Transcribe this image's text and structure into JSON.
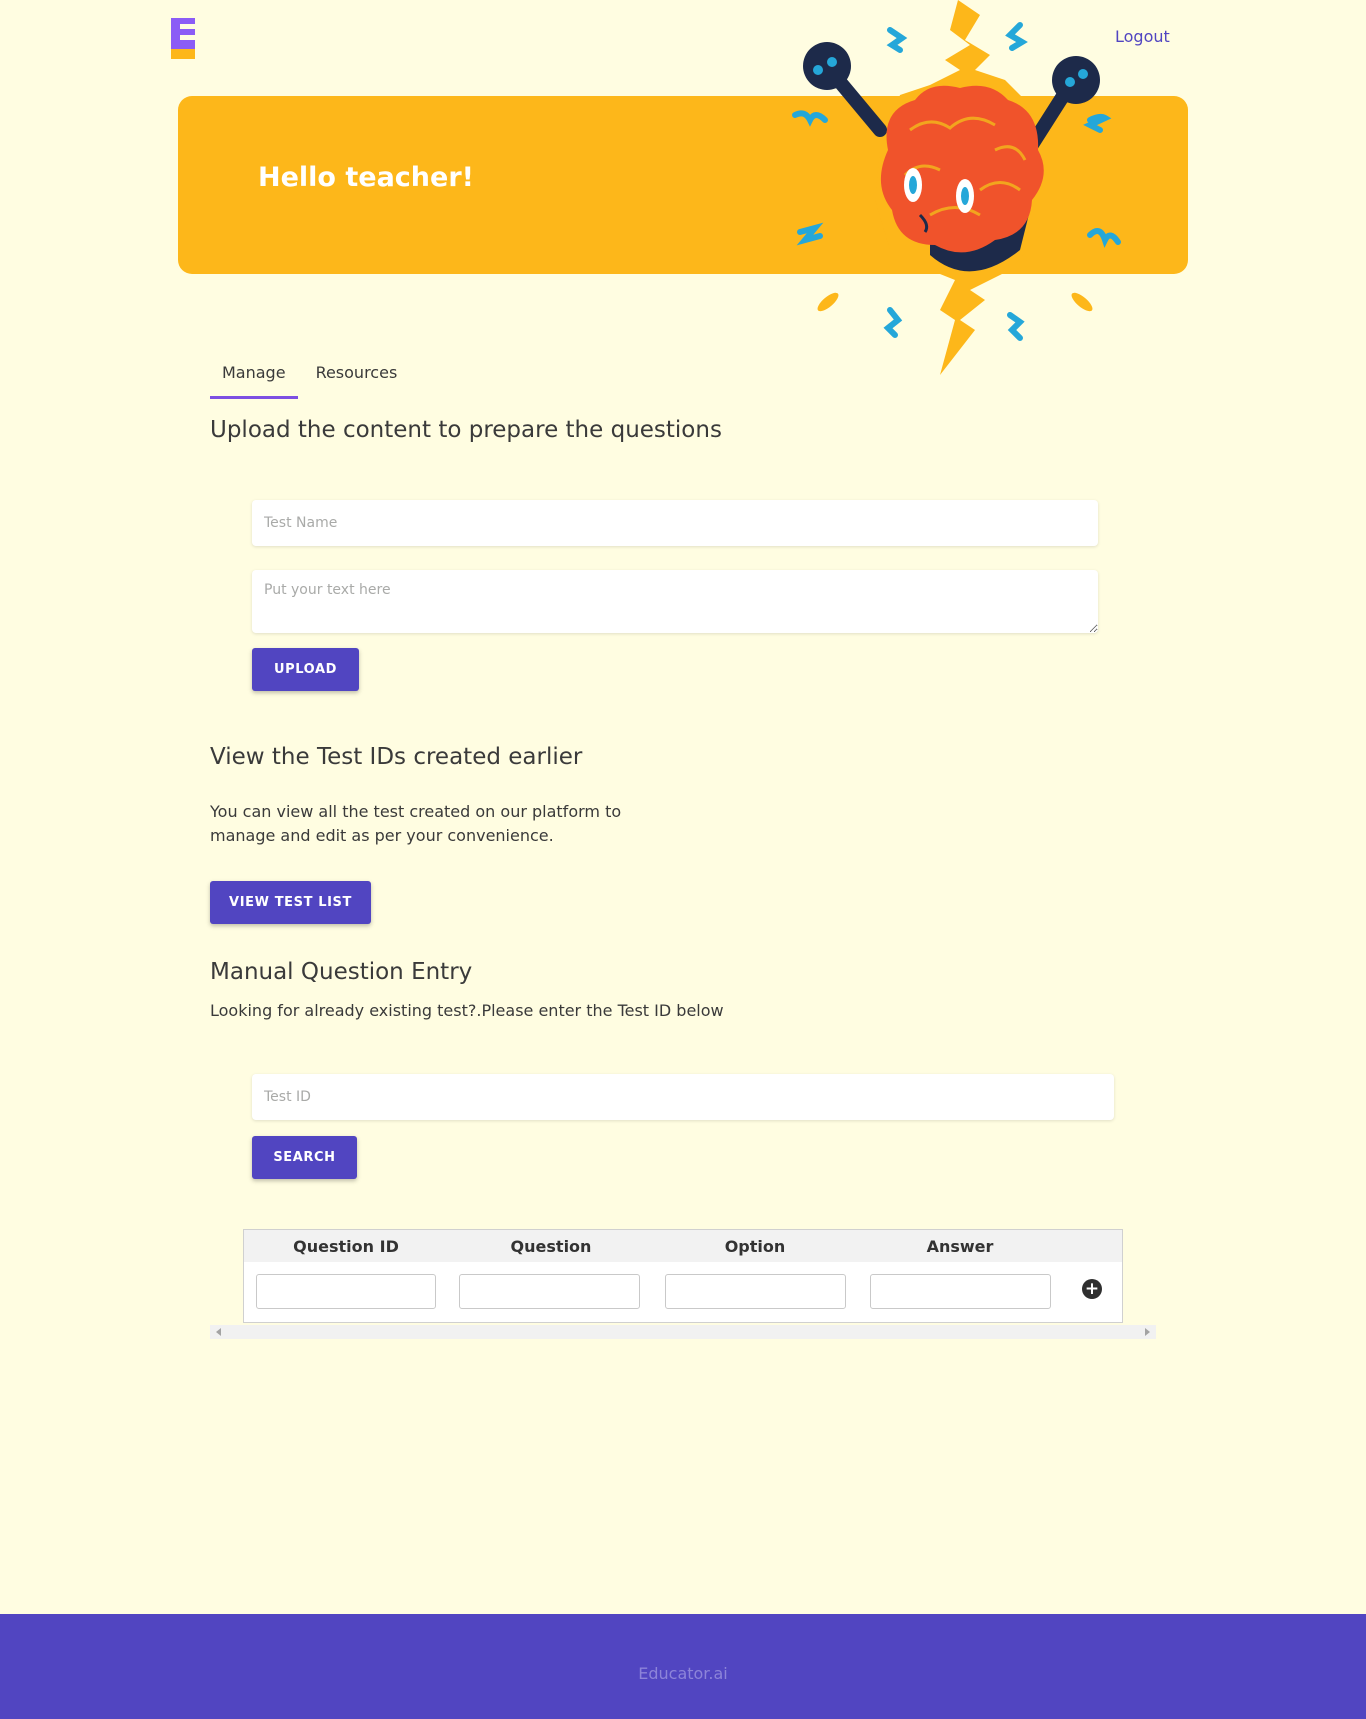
{
  "header": {
    "logout_label": "Logout"
  },
  "hero": {
    "title": "Hello teacher!"
  },
  "tabs": [
    {
      "label": "Manage"
    },
    {
      "label": "Resources"
    }
  ],
  "upload_section": {
    "heading": "Upload the content to prepare the questions",
    "test_name_placeholder": "Test Name",
    "text_placeholder": "Put your text here",
    "upload_label": "UPLOAD"
  },
  "view_section": {
    "heading": "View the Test IDs created earlier",
    "description_line1": "You can view all the test created on our platform to",
    "description_line2": "manage and edit as per your convenience.",
    "button_label": "VIEW TEST LIST"
  },
  "manual_section": {
    "heading": "Manual Question Entry",
    "description": "Looking for already existing test?.Please enter the Test ID below",
    "test_id_placeholder": "Test ID",
    "search_label": "SEARCH"
  },
  "question_table": {
    "columns": [
      "Question ID",
      "Question",
      "Option",
      "Answer"
    ],
    "add_icon": "plus-circle-icon"
  },
  "footer": {
    "text": "Educator.ai"
  },
  "colors": {
    "background": "#fffde1",
    "hero": "#fdb71a",
    "primary": "#5145c1",
    "tab_underline": "#7d4fe2"
  }
}
